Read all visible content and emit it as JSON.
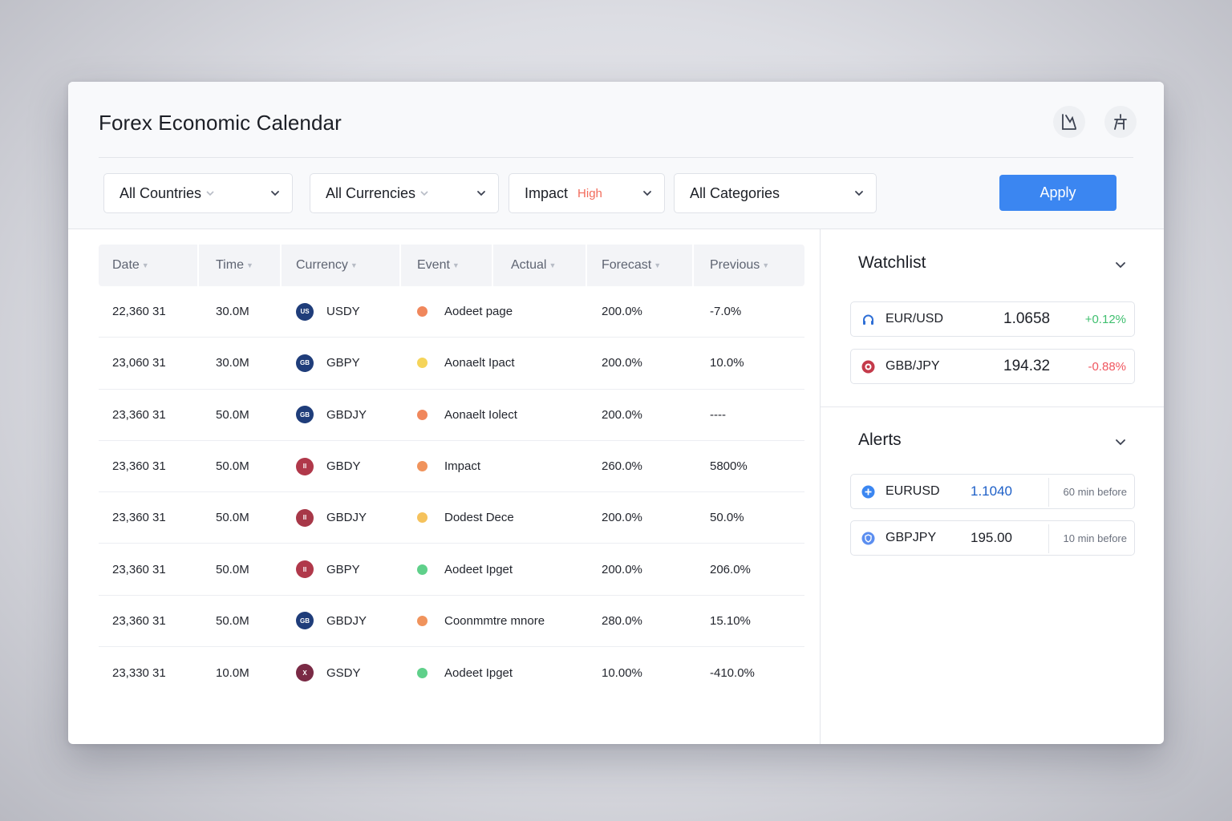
{
  "app": {
    "title": "Forex Economic Calendar"
  },
  "header_icons": [
    "chart-icon",
    "font-icon"
  ],
  "filters": {
    "countries": "All Countries",
    "currencies": "All Currencies",
    "impact_label": "Impact",
    "impact_value": "High",
    "categories": "All Categories",
    "apply": "Apply"
  },
  "table": {
    "columns": [
      "Date",
      "Time",
      "Currency",
      "Event",
      "Actual",
      "Forecast",
      "Previous"
    ],
    "rows": [
      {
        "date": "22,360 31",
        "time": "30.0M",
        "badge": "US",
        "badge_color": "#1f3d7a",
        "currency": "USDY",
        "impact_color": "#f0875c",
        "event": "Aodeet page",
        "forecast": "200.0%",
        "previous": "-7.0%"
      },
      {
        "date": "23,060 31",
        "time": "30.0M",
        "badge": "GB",
        "badge_color": "#1f3d7a",
        "currency": "GBPY",
        "impact_color": "#f5d45a",
        "event": "Aonaelt Ipact",
        "forecast": "200.0%",
        "previous": "10.0%"
      },
      {
        "date": "23,360 31",
        "time": "50.0M",
        "badge": "GB",
        "badge_color": "#1f3d7a",
        "currency": "GBDJY",
        "impact_color": "#f0875c",
        "event": "Aonaelt Iolect",
        "forecast": "200.0%",
        "previous": "----"
      },
      {
        "date": "23,360 31",
        "time": "50.0M",
        "badge": "II",
        "badge_color": "#b0384a",
        "currency": "GBDY",
        "impact_color": "#f0935c",
        "event": "Impact",
        "forecast": "260.0%",
        "previous": "5800%"
      },
      {
        "date": "23,360 31",
        "time": "50.0M",
        "badge": "II",
        "badge_color": "#a73848",
        "currency": "GBDJY",
        "impact_color": "#f5c25c",
        "event": "Dodest Dece",
        "forecast": "200.0%",
        "previous": "50.0%"
      },
      {
        "date": "23,360 31",
        "time": "50.0M",
        "badge": "II",
        "badge_color": "#b0384a",
        "currency": "GBPY",
        "impact_color": "#5fd08a",
        "event": "Aodeet Ipget",
        "forecast": "200.0%",
        "previous": "206.0%"
      },
      {
        "date": "23,360 31",
        "time": "50.0M",
        "badge": "GB",
        "badge_color": "#1f3d7a",
        "currency": "GBDJY",
        "impact_color": "#f0935c",
        "event": "Coonmmtre mnore",
        "forecast": "280.0%",
        "previous": "15.10%"
      },
      {
        "date": "23,330 31",
        "time": "10.0M",
        "badge": "X",
        "badge_color": "#7a2a45",
        "currency": "GSDY",
        "impact_color": "#5fd08a",
        "event": "Aodeet Ipget",
        "forecast": "10.00%",
        "previous": "-410.0%"
      }
    ]
  },
  "watchlist": {
    "title": "Watchlist",
    "items": [
      {
        "pair": "EUR/USD",
        "price": "1.0658",
        "change": "+0.12%",
        "change_color": "#3fbf6f",
        "icon": "headphones-icon",
        "icon_color": "#2f6fd6"
      },
      {
        "pair": "GBB/JPY",
        "price": "194.32",
        "change": "-0.88%",
        "change_color": "#f0565f",
        "icon": "flag-icon",
        "icon_color": "#c43a4a"
      }
    ]
  },
  "alerts": {
    "title": "Alerts",
    "items": [
      {
        "pair": "EURUSD",
        "value": "1.1040",
        "value_color": "#1d5fc7",
        "when": "60 min before",
        "icon": "plus-circle-icon",
        "icon_color": "#3b86f1"
      },
      {
        "pair": "GBPJPY",
        "value": "195.00",
        "value_color": "#1c1f26",
        "when": "10 min before",
        "icon": "shield-icon",
        "icon_color": "#5b8ef0"
      }
    ]
  }
}
